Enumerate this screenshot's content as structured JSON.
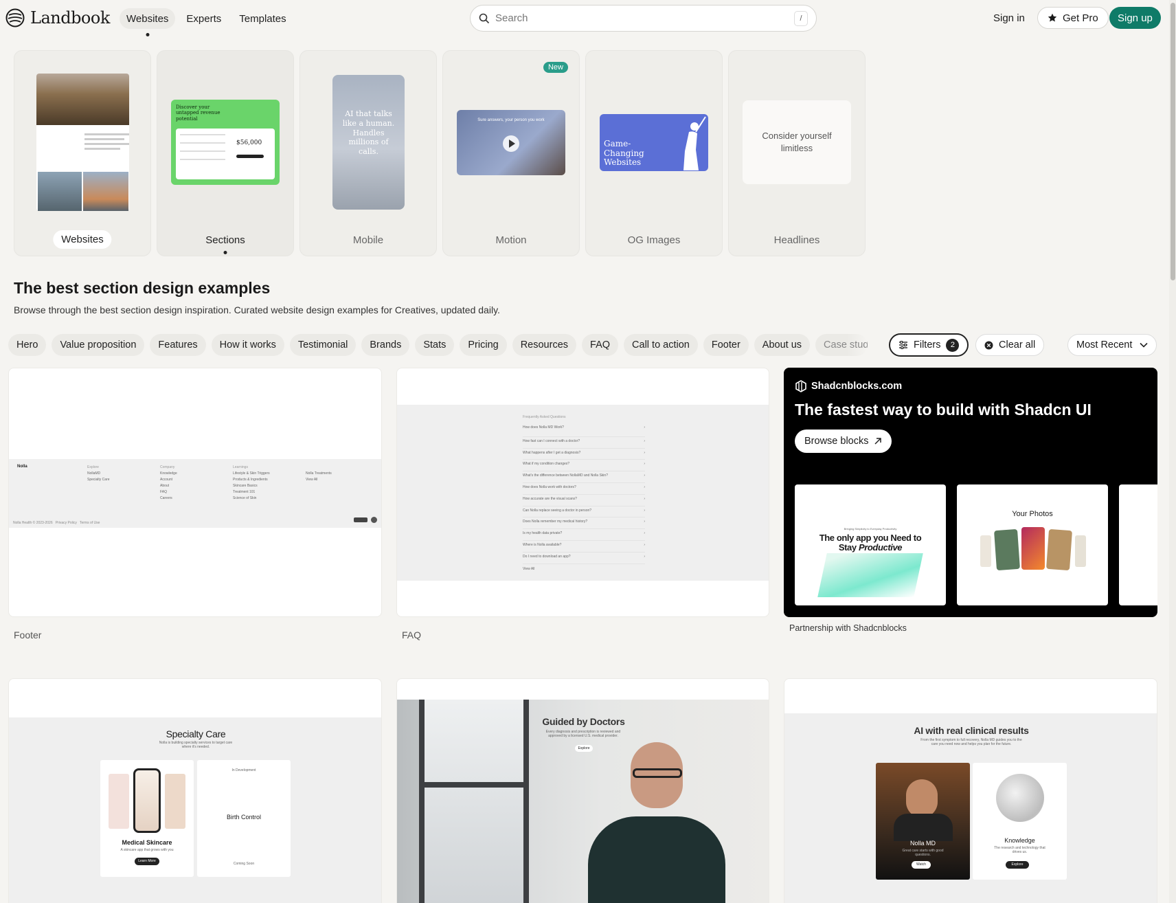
{
  "header": {
    "logo_text": "Landbook",
    "nav": [
      {
        "label": "Websites",
        "active": true
      },
      {
        "label": "Experts",
        "active": false
      },
      {
        "label": "Templates",
        "active": false
      }
    ],
    "search_placeholder": "Search",
    "search_shortcut": "/",
    "sign_in": "Sign in",
    "get_pro": "Get Pro",
    "sign_up": "Sign up"
  },
  "categories": [
    {
      "label": "Websites",
      "state": "pill"
    },
    {
      "label": "Sections",
      "state": "selected"
    },
    {
      "label": "Mobile",
      "state": "plain"
    },
    {
      "label": "Motion",
      "state": "plain",
      "badge": "New"
    },
    {
      "label": "OG Images",
      "state": "plain"
    },
    {
      "label": "Headlines",
      "state": "plain"
    }
  ],
  "category_previews": {
    "sections_card": {
      "headline": "Discover your untapped revenue potential",
      "amount": "$56,000"
    },
    "mobile_card": {
      "headline": "AI that talks like a human. Handles millions of calls."
    },
    "motion_card": {
      "headline": "Sure answers, your person you work"
    },
    "og_card": {
      "headline": "Game-Changing Websites"
    },
    "headline_card": {
      "text": "Consider yourself limitless"
    }
  },
  "page": {
    "title": "The best section design examples",
    "subtitle": "Browse through the best section design inspiration. Curated website design examples for Creatives, updated daily."
  },
  "filter_chips": [
    "Hero",
    "Value proposition",
    "Features",
    "How it works",
    "Testimonial",
    "Brands",
    "Stats",
    "Pricing",
    "Resources",
    "FAQ",
    "Call to action",
    "Footer",
    "About us",
    "Case study"
  ],
  "filters_button": {
    "label": "Filters",
    "count": "2"
  },
  "clear_all": "Clear all",
  "sort": {
    "selected": "Most Recent"
  },
  "results": {
    "footer_card": {
      "label": "Footer",
      "brand": "Nolla",
      "columns": [
        {
          "head": "Explore",
          "items": [
            "NollaMD",
            "Specialty Care"
          ]
        },
        {
          "head": "Company",
          "items": [
            "Knowledge",
            "Account",
            "About",
            "FAQ",
            "Careers"
          ]
        },
        {
          "head": "Learnings",
          "items": [
            "Lifestyle & Skin Triggers",
            "Products & Ingredients",
            "Skincare Basics",
            "Treatment 101",
            "Science of Skin"
          ]
        },
        {
          "head": "",
          "items": [
            "Nolla Treatments",
            "View All"
          ]
        }
      ],
      "legal": "Nolla Health © 2023-2026   Privacy Policy   Terms of Use"
    },
    "faq_card": {
      "label": "FAQ",
      "heading": "Frequently Asked Questions",
      "questions": [
        "How does Nolla MD Work?",
        "How fast can I connect with a doctor?",
        "What happens after I get a diagnosis?",
        "What if my condition changes?",
        "What's the difference between NollaMD and Nolla Skin?",
        "How does Nolla work with doctors?",
        "How accurate are the visual scans?",
        "Can Nolla replace seeing a doctor in person?",
        "Does Nolla remember my medical history?",
        "Is my health data private?",
        "Where is Nolla available?",
        "Do I need to download an app?"
      ],
      "view_all": "View All"
    },
    "ad_card": {
      "brand": "Shadcnblocks.com",
      "headline": "The fastest way to build with Shadcn UI",
      "cta": "Browse blocks",
      "label": "Partnership with Shadcnblocks",
      "tile1": {
        "kicker": "Bringing Simplicity to Everyday Productivity",
        "headline_a": "The only app you Need to",
        "headline_b": "Stay ",
        "headline_em": "Productive"
      },
      "tile2": {
        "headline": "Your Photos"
      }
    },
    "specialty_card": {
      "title": "Specialty Care",
      "subtitle": "Nolla is building specialty services to target care where it's needed.",
      "left_title": "Medical Skincare",
      "left_sub": "A skincare app that grows with you",
      "left_cta": "Learn More",
      "right_kicker": "In Development",
      "right_title": "Birth Control",
      "right_foot": "Coming Soon"
    },
    "doctors_card": {
      "title": "Guided by Doctors",
      "subtitle": "Every diagnosis and prescription is reviewed and approved by a licensed U.S. medical provider.",
      "cta": "Explore"
    },
    "ai_card": {
      "title": "AI with real clinical results",
      "subtitle": "From the first symptom to full recovery, Nolla MD guides you to the care you need now and helps you plan for the future.",
      "left_title": "Nolla MD",
      "left_sub": "Great care starts with good questions.",
      "left_cta": "Watch",
      "right_title": "Knowledge",
      "right_sub": "The research and technology that drives us.",
      "right_cta": "Explore"
    }
  },
  "colors": {
    "brand_green": "#0f7b68",
    "badge_teal": "#2a9d8a",
    "background": "#f5f4f1"
  }
}
